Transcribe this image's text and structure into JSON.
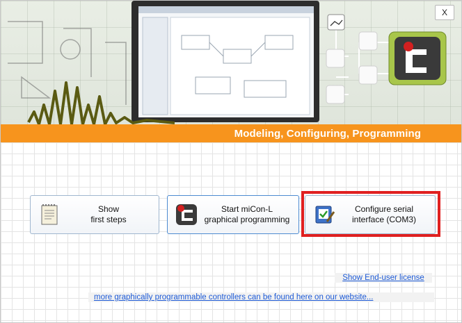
{
  "banner": {
    "tagline": "Modeling, Configuring, Programming",
    "colors": {
      "accent": "#f7941d",
      "wave": "#5a5a12",
      "node_bg": "#a8c64a"
    }
  },
  "window": {
    "close_label": "X"
  },
  "buttons": [
    {
      "label_line1": "Show",
      "label_line2": "first steps",
      "icon": "notepad-icon"
    },
    {
      "label_line1": "Start miCon-L",
      "label_line2": "graphical programming",
      "icon": "micon-logo-icon"
    },
    {
      "label_line1": "Configure serial",
      "label_line2": "interface (COM3)",
      "icon": "serial-config-icon"
    }
  ],
  "links": {
    "license": "Show End-user license",
    "website": "more graphically programmable controllers can be found here on our website..."
  }
}
